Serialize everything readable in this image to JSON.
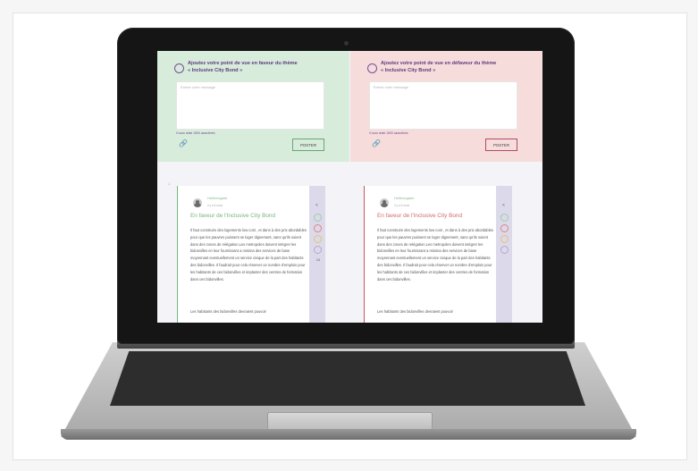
{
  "panels": {
    "for": {
      "title_line1": "Ajoutez votre point de vue en faveur du thème",
      "title_line2": "« Inclusive City Bond »",
      "placeholder": "Entrez votre message",
      "count": "Il vous reste 1500 caractères",
      "post_label": "POSTER"
    },
    "against": {
      "title_line1": "Ajoutez votre point de vue en défaveur du thème",
      "title_line2": "« Inclusive City Bond »",
      "placeholder": "Entrez votre message",
      "count": "Il vous reste 1500 caractères",
      "post_label": "POSTER"
    }
  },
  "cards": {
    "number": "1",
    "for": {
      "author": "Hellenegade",
      "date": "Il y a 6 mois",
      "title": "En faveur de l'Inclusive City Bond",
      "body": "Il faut construire des logements low cost , et dans à des prix abordables pour que les pauvres puissent se loger dignement, sans qu'ils soient dans des zones de relégation.Les metropoles doivent intégrer les bidonvilles en leur fournissant a minima des services de base moyennant eventuellement un service civique de la part des habitants des bidonvilles. Il faudrait pour cela réserver un nombre d'emplois pour les habitants de ces bidonvilles et implanter des centres de formation dans ces bidonvilles.",
      "body_more": "Les habitants des bidonvilles devraient pouvoir",
      "comment_count": "10"
    },
    "against": {
      "author": "Hellenegade",
      "date": "Il y a 6 mois",
      "title": "En faveur de l'Inclusive City Bond",
      "body": "Il faut construire des logements low cost , et dans à des prix abordables pour que les pauvres puissent se loger dignement, sans qu'ils soient dans des zones de relégation.Les metropoles doivent intégrer les bidonvilles en leur fournissant a minima des services de base moyennant eventuellement un service civique de la part des habitants des bidonvilles. Il faudrait pour cela réserver un nombre d'emplois pour les habitants de ces bidonvilles et implanter des centres de formation dans ces bidonvilles.",
      "body_more": "Les habitants des bidonvilles devraient pouvoir"
    }
  },
  "colors": {
    "for_bg": "#d8ecdc",
    "against_bg": "#f7dcdc",
    "for_accent": "#74b77e",
    "against_accent": "#c95656",
    "brand": "#5c3b7d"
  }
}
